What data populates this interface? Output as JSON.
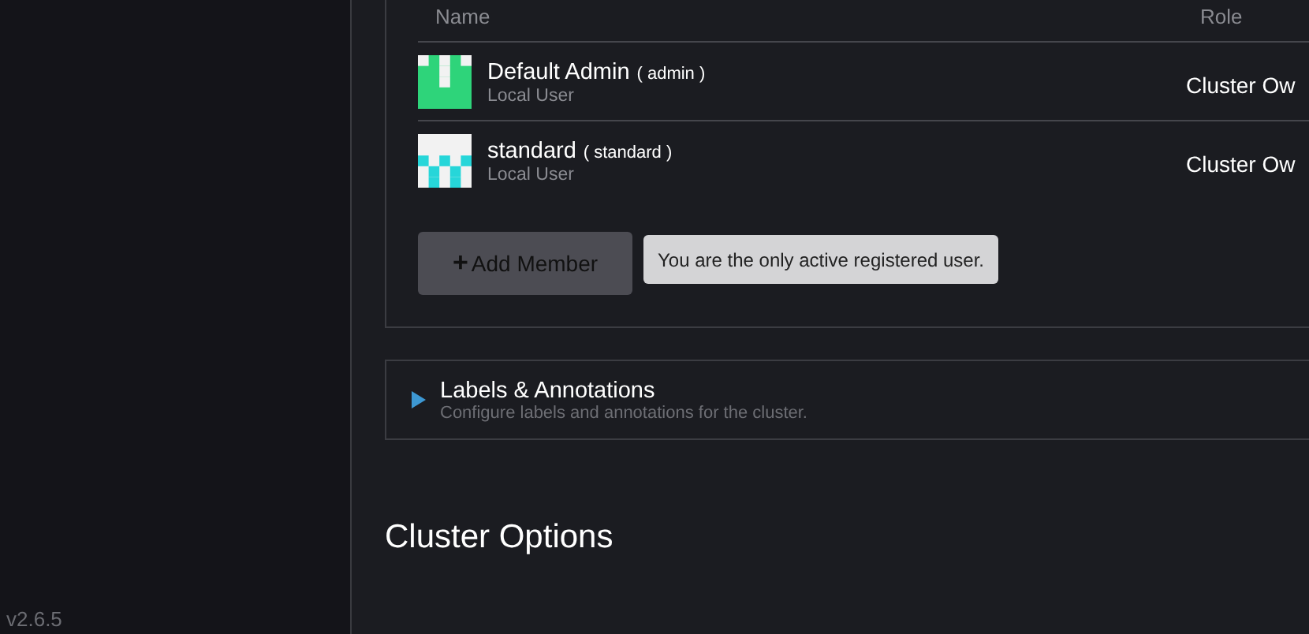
{
  "sidebar": {
    "version": "v2.6.5"
  },
  "members": {
    "columns": [
      "Name",
      "Role"
    ],
    "rows": [
      {
        "name": "Default Admin",
        "username": "( admin )",
        "type": "Local User",
        "role": "Cluster Ow",
        "color": "#2ed47a"
      },
      {
        "name": "standard",
        "username": "( standard )",
        "type": "Local User",
        "role": "Cluster Ow",
        "color": "#26d6d9"
      }
    ],
    "add_button": "Add Member",
    "add_icon": "+",
    "tooltip": "You are the only active registered user."
  },
  "labels_section": {
    "title": "Labels & Annotations",
    "description": "Configure labels and annotations for the cluster.",
    "expanded": false
  },
  "heading": "Cluster Options"
}
